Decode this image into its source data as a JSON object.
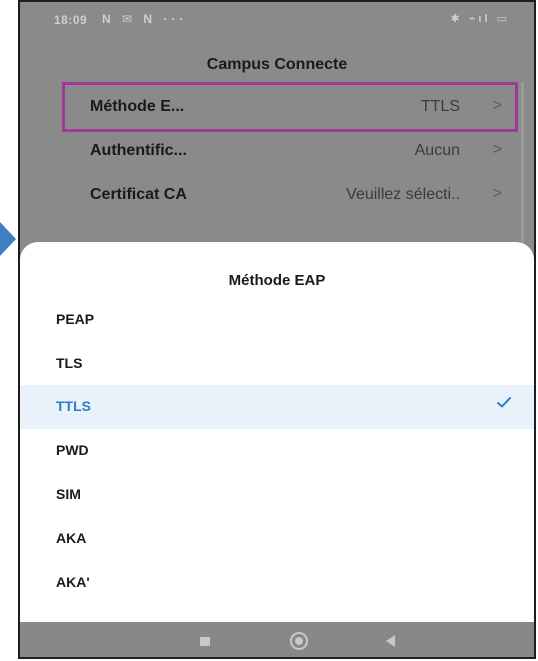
{
  "status_bar": {
    "time": "18:09",
    "left_icons": "N ✉ N ···",
    "right_icons": "✱ ⌁ıl ▭"
  },
  "settings": {
    "title": "Campus Connecte",
    "rows": [
      {
        "label": "Méthode E...",
        "value": "TTLS"
      },
      {
        "label": "Authentific...",
        "value": "Aucun"
      },
      {
        "label": "Certificat CA",
        "value": "Veuillez sélecti.."
      }
    ],
    "chevron": ">"
  },
  "sheet": {
    "title": "Méthode EAP",
    "options": [
      "PEAP",
      "TLS",
      "TTLS",
      "PWD",
      "SIM",
      "AKA",
      "AKA'"
    ],
    "selected": "TTLS"
  },
  "colors": {
    "accent": "#2b7bd0",
    "highlight_border": "#9b3b95",
    "side_arrow": "#3d7fc1"
  },
  "icons": {
    "checkmark": "check-icon",
    "nav": [
      "recents-icon",
      "home-icon",
      "back-icon"
    ]
  }
}
